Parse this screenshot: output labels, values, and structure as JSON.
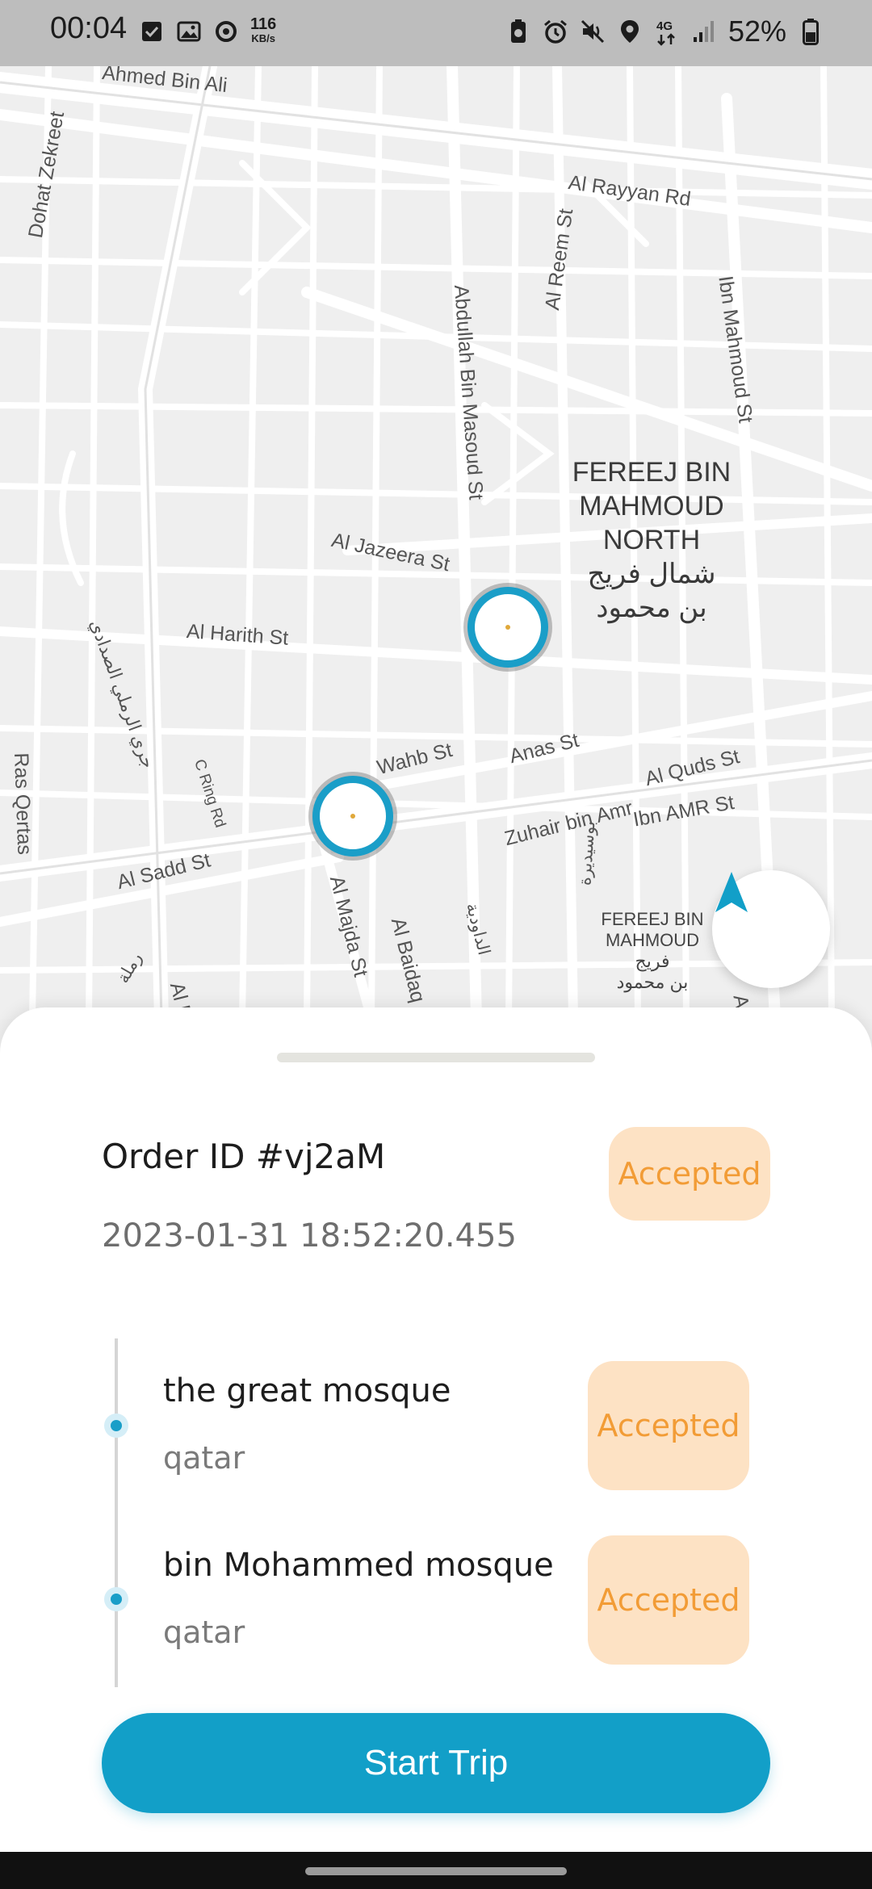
{
  "status_bar": {
    "time": "00:04",
    "speed_value": "116",
    "speed_unit": "KB/s",
    "network": "4G",
    "battery": "52%",
    "left_icons": [
      "checkbox-icon",
      "image-icon",
      "sync-icon"
    ],
    "right_icons": [
      "battery-saver-icon",
      "alarm-icon",
      "mute-icon",
      "location-icon",
      "network-4g-icon",
      "signal-icon",
      "battery-icon"
    ]
  },
  "map": {
    "streets": [
      "Ahmed Bin Ali",
      "Dohat Zekreet",
      "Al Rayyan Rd",
      "Al Reem St",
      "Ibn Mahmoud St",
      "Abdullah Bin Masoud St",
      "Al Jazeera St",
      "Al Harith St",
      "جري الرملي الصدادي",
      "Ras Qertas",
      "C Ring Rd",
      "Wahb St",
      "Anas St",
      "Al Quds St",
      "Zuhair bin Amr",
      "Ibn AMR St",
      "Al Sadd St",
      "Al Majda St",
      "Al Baidaq",
      "الداودية",
      "بوسيديرة",
      "رملة",
      "Al F",
      "Al"
    ],
    "district_main": [
      "FEREEJ BIN",
      "MAHMOUD",
      "NORTH",
      "شمال فريج",
      "بن محمود"
    ],
    "district_small": [
      "FEREEJ BIN",
      "MAHMOUD",
      "فريج",
      "بن محمود"
    ],
    "markers": [
      "pickup-marker",
      "dropoff-marker"
    ],
    "navigate_icon": "navigation-arrow-icon"
  },
  "order": {
    "id_label": "Order ID #vj2aM",
    "datetime": "2023-01-31 18:52:20.455",
    "status": "Accepted"
  },
  "stops": [
    {
      "title": "the great mosque",
      "subtitle": "qatar",
      "status": "Accepted"
    },
    {
      "title": "bin Mohammed mosque",
      "subtitle": "qatar",
      "status": "Accepted"
    }
  ],
  "actions": {
    "start_trip": "Start Trip"
  },
  "colors": {
    "accent": "#129fc8",
    "badge_bg": "#fde2c4",
    "badge_text": "#f29c36"
  }
}
